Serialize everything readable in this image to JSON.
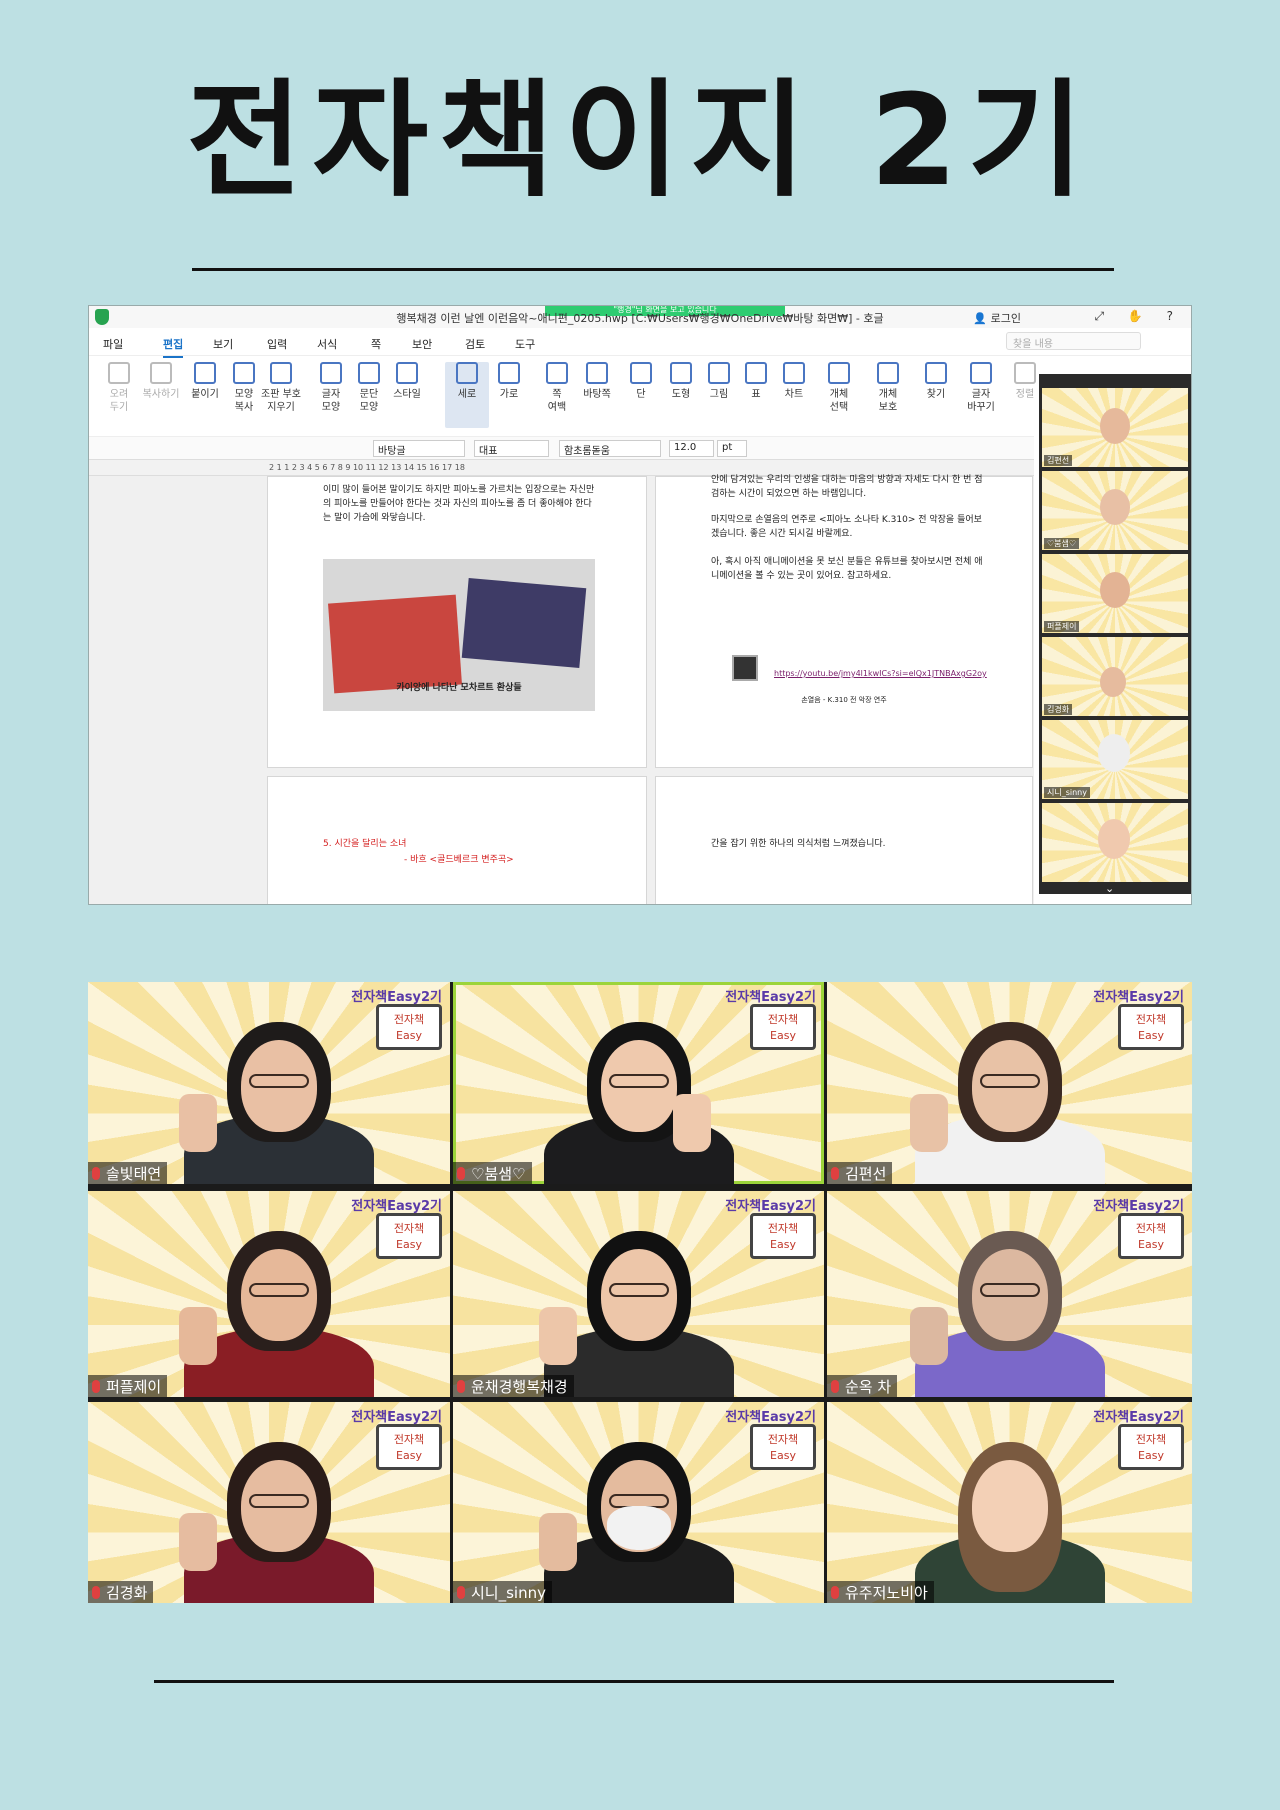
{
  "page_title": "전자책이지 2기",
  "screenshot": {
    "window_title": "행복채경 이런 날엔 이런음악~애니편_0205.hwp [C:₩Users₩행경₩OneDrive₩바탕 화면₩] - 호글",
    "share_banner": "\"행경\"님 화면을 보고 있습니다",
    "login_label": "로그인",
    "title_icons": "⤢ ✋ ?",
    "menu": [
      "파일",
      "편집",
      "보기",
      "입력",
      "서식",
      "쪽",
      "보안",
      "검토",
      "도구"
    ],
    "active_menu": "편집",
    "search_placeholder": "찾을 내용",
    "ribbon": [
      {
        "label": "오려\n두기",
        "dim": true
      },
      {
        "label": "복사하기",
        "dim": true
      },
      {
        "label": "붙이기"
      },
      {
        "label": "모양\n복사"
      },
      {
        "label": "조판 부호\n지우기"
      },
      {
        "label": "글자\n모양"
      },
      {
        "label": "문단\n모양"
      },
      {
        "label": "스타일"
      },
      {
        "label": "세로",
        "selected": true
      },
      {
        "label": "가로"
      },
      {
        "label": "쪽\n여백"
      },
      {
        "label": "바탕쪽"
      },
      {
        "label": "단"
      },
      {
        "label": "도형"
      },
      {
        "label": "그림"
      },
      {
        "label": "표"
      },
      {
        "label": "차트"
      },
      {
        "label": "개체\n선택"
      },
      {
        "label": "개체\n보호"
      },
      {
        "label": "찾기"
      },
      {
        "label": "글자\n바꾸기"
      },
      {
        "label": "정렬",
        "dim": true
      }
    ],
    "format_bar": {
      "style": "바탕글",
      "lang": "대표",
      "font": "함초롬돋움",
      "size": "12.0",
      "unit": "pt"
    },
    "ruler_text": "2  1  1  2  3  4  5  6  7  8  9  10  11  12  13  14  15  16  17  18",
    "page1": {
      "text1": "이미 많이 들어본 말이기도 하지만 피아노를 가르치는 입장으로는 자신만의 피아노를 만들어야 한다는 것과 자신의 피아노를 좀 더 좋아해야 한다는 말이 가슴에 와닿습니다.",
      "caption": "카이앙에 나타난 모차르트 환상들"
    },
    "page2": {
      "text1": "안에 담겨있는 우리의 인생을 대하는 마음의 방향과 자세도 다시 한 번 점검하는 시간이 되었으면 하는 바램입니다.",
      "text2": "마지막으로 손열음의 연주로 <피아노 소나타 K.310> 전 악장을 들어보겠습니다. 좋은 시간 되시길 바랄께요.",
      "text3": "아, 혹시 아직 애니메이션을 못 보신 분들은 유튜브를 찾아보시면 전체 애니메이션을 볼 수 있는 곳이 있어요. 참고하세요.",
      "link": "https://youtu.be/jmy4l1kwICs?si=elQx1JTNBAxgG2oy",
      "link_caption": "손열음 - K.310 전 악장 연주"
    },
    "page3": {
      "heading": "5. 시간을 달리는 소녀",
      "sub": "- 바흐 <골드베르크 변주곡>"
    },
    "page4": {
      "text": "간을 잡기 위한 하나의 의식처럼 느껴졌습니다."
    },
    "video_names": [
      "김편선",
      "♡붐샘♡",
      "퍼플제이",
      "김경화",
      "시니_sinny",
      ""
    ]
  },
  "gallery": {
    "badge_text": "전자책Easy2기",
    "logo_text": "전자책\nEasy",
    "participants": [
      "솔빛태연",
      "♡붐샘♡",
      "김편선",
      "퍼플제이",
      "윤채경행복채경",
      "순옥 차",
      "김경화",
      "시니_sinny",
      "유주저노비아"
    ]
  }
}
